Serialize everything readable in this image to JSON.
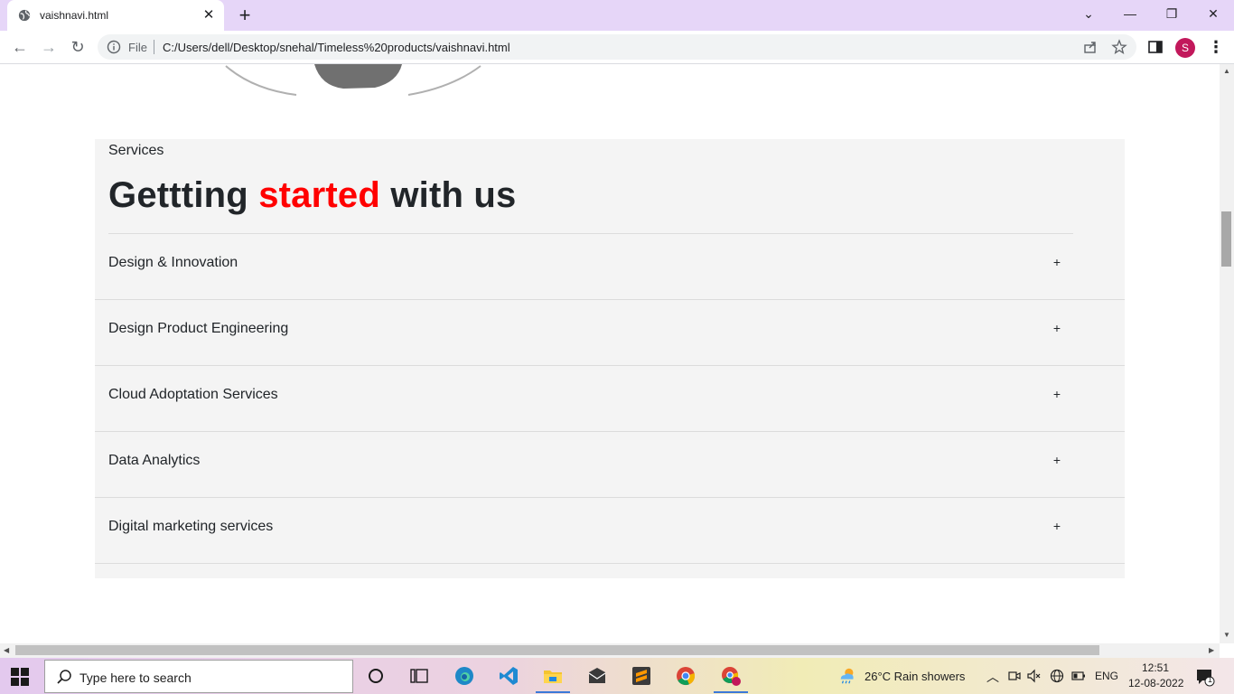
{
  "browser": {
    "tab_title": "vaishnavi.html",
    "new_tab": "+",
    "scheme_label": "File",
    "url": "C:/Users/dell/Desktop/snehal/Timeless%20products/vaishnavi.html",
    "profile_initial": "S",
    "accent": "#e6d6f8"
  },
  "page": {
    "section_label": "Services",
    "heading_pre": "Gettting ",
    "heading_accent": "started",
    "heading_post": " with us",
    "accent_color": "#ff0000",
    "plus": "+",
    "items": [
      {
        "label": "Design & Innovation"
      },
      {
        "label": "Design Product Engineering"
      },
      {
        "label": "Cloud Adoptation Services"
      },
      {
        "label": "Data Analytics"
      },
      {
        "label": "Digital marketing services"
      }
    ]
  },
  "taskbar": {
    "search_placeholder": "Type here to search",
    "weather": "26°C  Rain showers",
    "language": "ENG",
    "time": "12:51",
    "date": "12-08-2022",
    "notification_count": "1"
  }
}
